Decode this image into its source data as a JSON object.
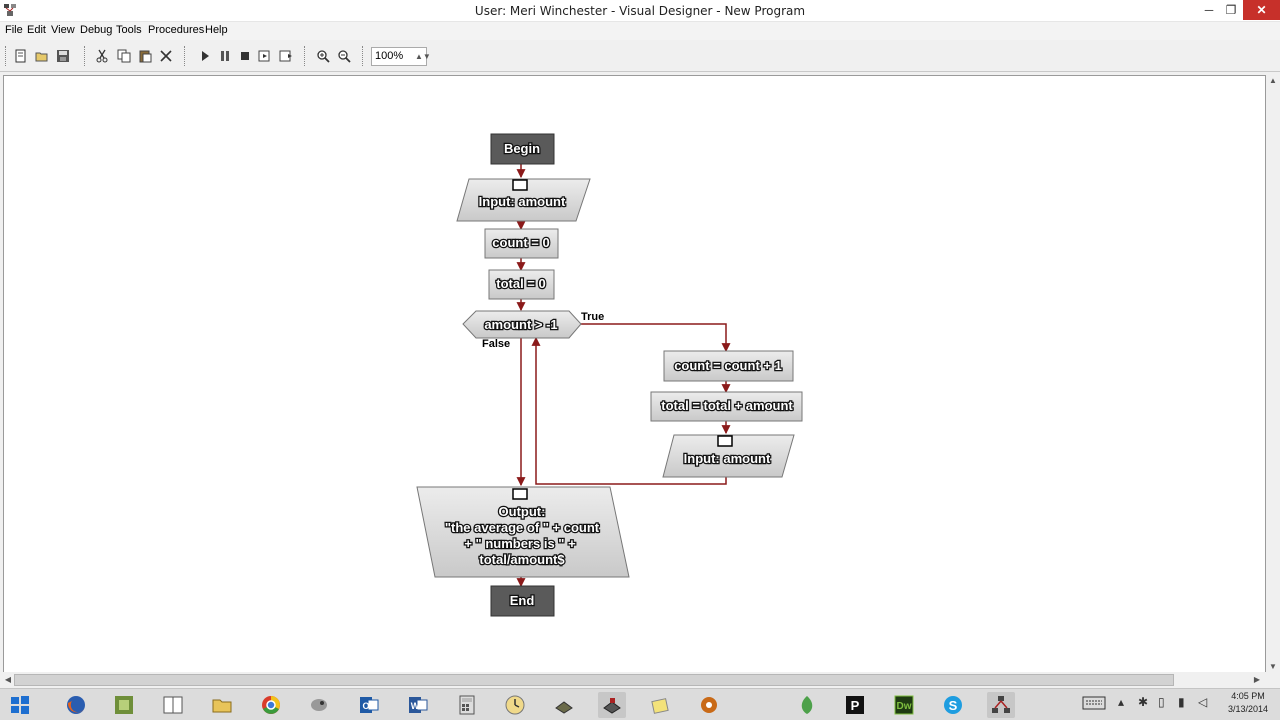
{
  "window": {
    "title": "User: Meri Winchester - Visual Designer - New Program",
    "min_label": "─",
    "max_label": "❐",
    "close_label": "✕"
  },
  "menu": {
    "items": [
      "File",
      "Edit",
      "View",
      "Debug",
      "Tools",
      "Procedures",
      "Help"
    ]
  },
  "toolbar": {
    "zoom": "100%",
    "buttons": [
      "new-icon",
      "open-icon",
      "save-icon",
      "cut-icon",
      "copy-icon",
      "paste-icon",
      "delete-icon",
      "run-icon",
      "pause-icon",
      "stop-icon",
      "step-icon",
      "step-over-icon",
      "zoom-in-icon",
      "zoom-out-icon"
    ]
  },
  "flowchart": {
    "begin": "Begin",
    "input1": "Input: amount",
    "count_init": "count = 0",
    "total_init": "total = 0",
    "condition": "amount > -1",
    "true_label": "True",
    "false_label": "False",
    "count_inc": "count = count + 1",
    "total_add": "total = total + amount",
    "input2": "Input: amount",
    "output_title": "Output:",
    "output_line1": "\"the average of  \" + count",
    "output_line2": "+ \" numbers is \" +",
    "output_line3": "total/amount$",
    "end": "End"
  },
  "taskbar": {
    "apps": [
      "start-icon",
      "firefox-icon",
      "vmware-icon",
      "file-explorer-icon",
      "folder-icon",
      "chrome-icon",
      "raptor-icon",
      "outlook-icon",
      "word-icon",
      "calculator-icon",
      "clock-icon",
      "network-icon",
      "designer-icon",
      "sticky-notes-icon",
      "settings-gear-icon",
      "app-green-icon",
      "publisher-icon",
      "dreamweaver-icon",
      "skype-icon",
      "visual-designer-icon"
    ],
    "time": "4:05 PM",
    "date": "3/13/2014"
  },
  "colors": {
    "connector": "#8b1a1a",
    "terminal": "#555555",
    "shape_fill": "#d8d8d8"
  }
}
